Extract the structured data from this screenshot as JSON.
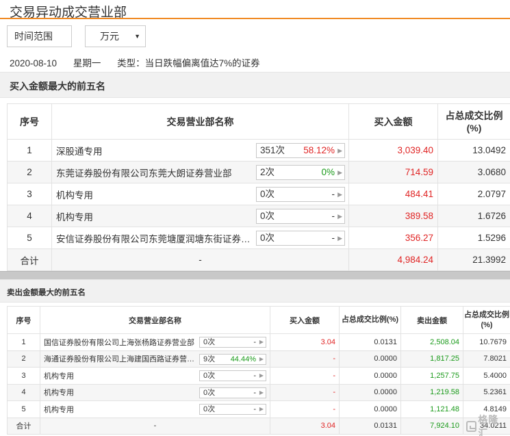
{
  "title": "交易异动成交营业部",
  "controls": {
    "range_label": "时间范围",
    "unit_label": "万元"
  },
  "info": {
    "date": "2020-08-10",
    "weekday": "星期一",
    "type": "类型：当日跌幅偏离值达7%的证券"
  },
  "buy_section": {
    "heading": "买入金额最大的前五名",
    "columns": [
      "序号",
      "交易营业部名称",
      "买入金额",
      "占总成交比例(%)"
    ],
    "rows": [
      {
        "no": "1",
        "name": "深股通专用",
        "count": "351次",
        "pct": "58.12%",
        "pct_color": "red",
        "amount": "3,039.40",
        "ratio": "13.0492"
      },
      {
        "no": "2",
        "name": "东莞证券股份有限公司东莞大朗证券营业部",
        "count": "2次",
        "pct": "0%",
        "pct_color": "green",
        "amount": "714.59",
        "ratio": "3.0680"
      },
      {
        "no": "3",
        "name": "机构专用",
        "count": "0次",
        "pct": "-",
        "pct_color": "",
        "amount": "484.41",
        "ratio": "2.0797"
      },
      {
        "no": "4",
        "name": "机构专用",
        "count": "0次",
        "pct": "-",
        "pct_color": "",
        "amount": "389.58",
        "ratio": "1.6726"
      },
      {
        "no": "5",
        "name": "安信证券股份有限公司东莞塘厦润塘东街证券营业部",
        "count": "0次",
        "pct": "-",
        "pct_color": "",
        "amount": "356.27",
        "ratio": "1.5296"
      }
    ],
    "total": {
      "label": "合计",
      "name": "-",
      "amount": "4,984.24",
      "ratio": "21.3992"
    }
  },
  "sell_section": {
    "heading": "卖出金额最大的前五名",
    "columns": [
      "序号",
      "交易营业部名称",
      "买入金额",
      "占总成交比例(%)",
      "卖出金额",
      "占总成交比例(%)"
    ],
    "rows": [
      {
        "no": "1",
        "name": "国信证券股份有限公司上海张杨路证券营业部",
        "count": "0次",
        "pct": "-",
        "pct_color": "",
        "buy": "3.04",
        "buy_ratio": "0.0131",
        "sell": "2,508.04",
        "sell_ratio": "10.7679"
      },
      {
        "no": "2",
        "name": "海通证券股份有限公司上海建国西路证券营业部",
        "count": "9次",
        "pct": "44.44%",
        "pct_color": "green",
        "buy": "-",
        "buy_ratio": "0.0000",
        "sell": "1,817.25",
        "sell_ratio": "7.8021"
      },
      {
        "no": "3",
        "name": "机构专用",
        "count": "0次",
        "pct": "-",
        "pct_color": "",
        "buy": "-",
        "buy_ratio": "0.0000",
        "sell": "1,257.75",
        "sell_ratio": "5.4000"
      },
      {
        "no": "4",
        "name": "机构专用",
        "count": "0次",
        "pct": "-",
        "pct_color": "",
        "buy": "-",
        "buy_ratio": "0.0000",
        "sell": "1,219.58",
        "sell_ratio": "5.2361"
      },
      {
        "no": "5",
        "name": "机构专用",
        "count": "0次",
        "pct": "-",
        "pct_color": "",
        "buy": "-",
        "buy_ratio": "0.0000",
        "sell": "1,121.48",
        "sell_ratio": "4.8149"
      }
    ],
    "total": {
      "label": "合计",
      "name": "-",
      "buy": "3.04",
      "buy_ratio": "0.0131",
      "sell": "7,924.10",
      "sell_ratio": "34.0211"
    }
  },
  "watermark": "格隆汇",
  "colors": {
    "accent": "#f08a24",
    "up": "#e02424",
    "down": "#1a9a1a"
  },
  "icons": {
    "dropdown": "caret-down-icon",
    "detail": "triangle-right-icon"
  }
}
